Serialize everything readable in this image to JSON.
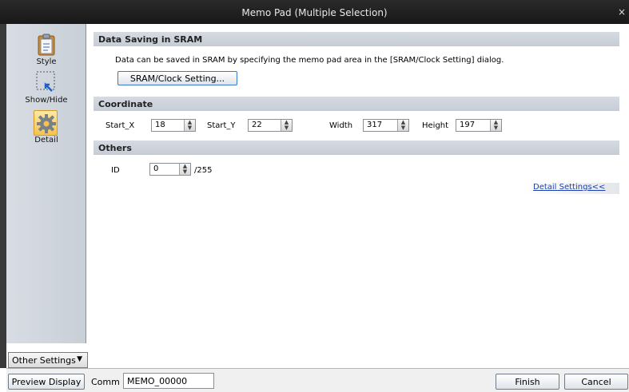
{
  "window": {
    "title": "Memo Pad (Multiple Selection)",
    "close_glyph": "×"
  },
  "sidebar": {
    "items": [
      {
        "label": "Style",
        "icon": "clipboard-icon"
      },
      {
        "label": "Show/Hide",
        "icon": "cursor-selection-icon"
      },
      {
        "label": "Detail",
        "icon": "gear-icon",
        "selected": true
      }
    ],
    "other_settings": {
      "label": "Other Settings",
      "arrow": "▼"
    }
  },
  "sram": {
    "header": "Data Saving in SRAM",
    "description": "Data can be saved in SRAM by specifying the memo pad area in the [SRAM/Clock Setting] dialog.",
    "button": "SRAM/Clock Setting..."
  },
  "coordinate": {
    "header": "Coordinate",
    "start_x_label": "Start_X",
    "start_x": "18",
    "start_y_label": "Start_Y",
    "start_y": "22",
    "width_label": "Width",
    "width": "317",
    "height_label": "Height",
    "height": "197"
  },
  "others": {
    "header": "Others",
    "id_label": "ID",
    "id": "0",
    "id_max": "/255",
    "detail_link": "Detail Settings<<"
  },
  "footer": {
    "preview_button": "Preview Display",
    "comm_label": "Comm",
    "comm_value": "MEMO_00000",
    "finish_button": "Finish",
    "cancel_button": "Cancel"
  },
  "colors": {
    "accent_selected": "#f6c34c",
    "link": "#1a3fb0",
    "titlebar": "#1f1f1f"
  }
}
